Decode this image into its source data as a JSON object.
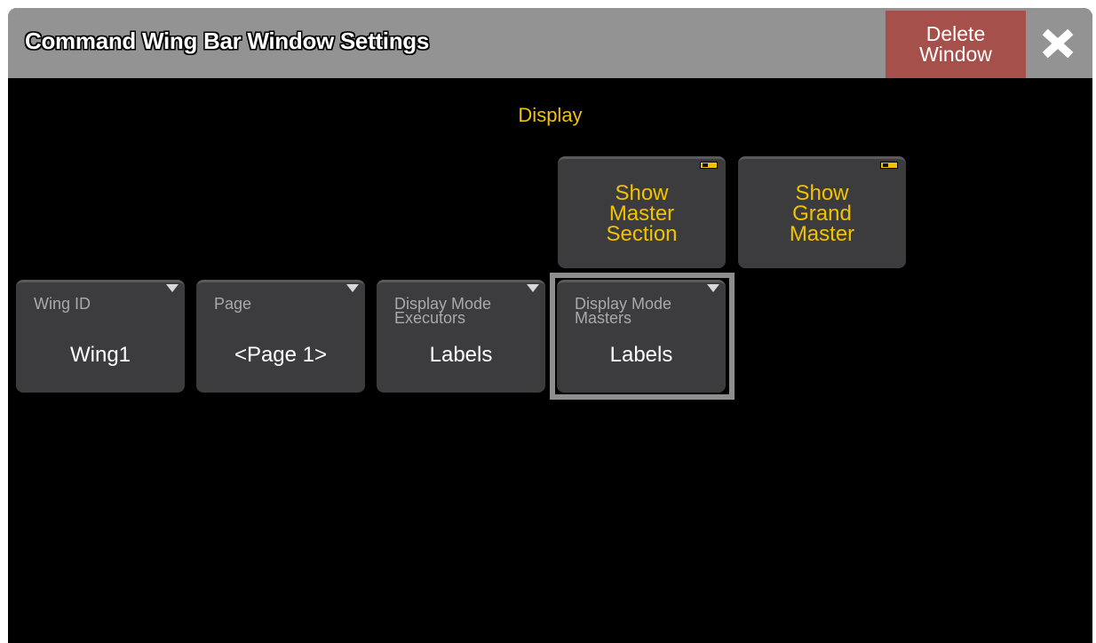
{
  "window": {
    "title": "Command Wing Bar Window Settings",
    "delete_button": {
      "line1": "Delete",
      "line2": "Window"
    },
    "close_icon": "close-icon"
  },
  "display_section": {
    "title": "Display",
    "toggles": [
      {
        "lines": [
          "Show",
          "Master",
          "Section"
        ],
        "state": "on"
      },
      {
        "lines": [
          "Show",
          "Grand",
          "Master"
        ],
        "state": "on"
      }
    ],
    "selects": [
      {
        "label_lines": [
          "Wing ID"
        ],
        "value": "Wing1"
      },
      {
        "label_lines": [
          "Page"
        ],
        "value": "<Page 1>"
      },
      {
        "label_lines": [
          "Display Mode",
          "Executors"
        ],
        "value": "Labels"
      },
      {
        "label_lines": [
          "Display Mode",
          "Masters"
        ],
        "value": "Labels",
        "selected": true
      }
    ]
  },
  "colors": {
    "accent_yellow": "#f2c200",
    "titlebar": "#939393",
    "delete_button": "#a5504a",
    "button_bg": "#3c3c3e",
    "background": "#000000"
  }
}
